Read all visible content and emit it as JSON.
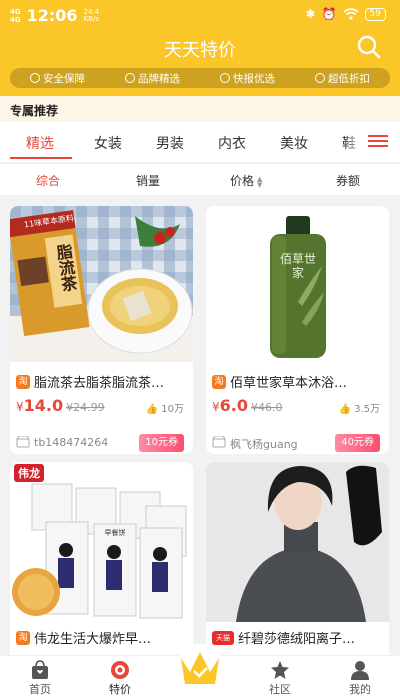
{
  "status_bar": {
    "network_top": "4G",
    "network_bottom": "4G",
    "time": "12:06",
    "speed_value": "24.4",
    "speed_unit": "KB/s",
    "icons": [
      "bluetooth-icon",
      "alarm-icon",
      "wifi-icon"
    ],
    "battery": "59"
  },
  "header": {
    "title": "天天特价",
    "search_icon": "search-icon",
    "features": [
      "安全保障",
      "品牌精选",
      "快报优选",
      "超低折扣"
    ]
  },
  "recommend": {
    "label": "专属推荐"
  },
  "categories": {
    "items": [
      "精选",
      "女装",
      "男装",
      "内衣",
      "美妆",
      "鞋"
    ],
    "active_index": 0,
    "menu_icon": "menu-icon"
  },
  "sort": {
    "items": [
      "综合",
      "销量",
      "价格",
      "券额"
    ],
    "active_index": 0
  },
  "products": [
    {
      "badge": "淘",
      "title": "脂流茶去脂茶脂流茶…",
      "image_caption": "脂流茶",
      "image_banner": "11味草本原料",
      "yen": "¥",
      "price": "14.0",
      "original_price": "¥24.99",
      "sales": "10万",
      "shop": "tb148474264",
      "coupon": "10元券"
    },
    {
      "badge": "淘",
      "title": "佰草世家草本沐浴…",
      "image_caption": "佰草世家",
      "yen": "¥",
      "price": "6.0",
      "original_price": "¥46.0",
      "sales": "3.5万",
      "shop": "枫飞杨guang",
      "coupon": "40元券"
    },
    {
      "badge": "淘",
      "title": "伟龙生活大爆炸早…",
      "image_caption": "伟龙",
      "box_label": "早餐饼"
    },
    {
      "badge": "天猫",
      "title": "纤碧莎德绒阳离子…"
    }
  ],
  "bottom_nav": {
    "items": [
      "首页",
      "特价",
      "",
      "社区",
      "我的"
    ],
    "active_index": 1
  },
  "colors": {
    "brand_yellow": "#fbc628",
    "accent_red": "#e8473b",
    "taobao_orange": "#f47a1f",
    "coupon_pink": "#ff4d6d"
  }
}
